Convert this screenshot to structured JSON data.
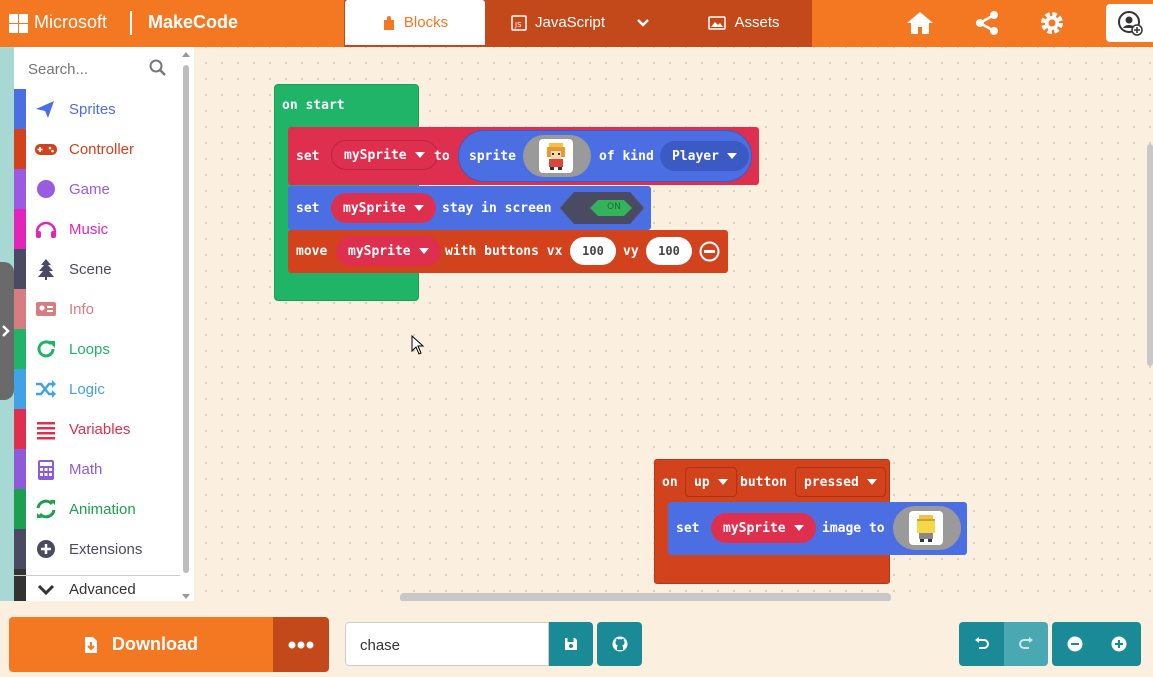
{
  "header": {
    "brand_ms": "Microsoft",
    "brand_app": "MakeCode",
    "tabs": {
      "blocks": "Blocks",
      "javascript": "JavaScript",
      "assets": "Assets"
    }
  },
  "toolbox": {
    "search_placeholder": "Search...",
    "categories": [
      {
        "label": "Sprites",
        "color": "#4b6fe2",
        "icon": "paper-plane-icon"
      },
      {
        "label": "Controller",
        "color": "#d2421c",
        "icon": "gamepad-icon"
      },
      {
        "label": "Game",
        "color": "#9a5be0",
        "icon": "circle-icon"
      },
      {
        "label": "Music",
        "color": "#e025b8",
        "icon": "headphones-icon"
      },
      {
        "label": "Scene",
        "color": "#4b4a63",
        "icon": "tree-icon"
      },
      {
        "label": "Info",
        "color": "#d67d83",
        "icon": "id-card-icon"
      },
      {
        "label": "Loops",
        "color": "#1fb468",
        "icon": "refresh-icon"
      },
      {
        "label": "Logic",
        "color": "#42a2e6",
        "icon": "shuffle-icon"
      },
      {
        "label": "Variables",
        "color": "#df2f4f",
        "icon": "list-icon"
      },
      {
        "label": "Math",
        "color": "#8e5bd8",
        "icon": "calculator-icon"
      },
      {
        "label": "Animation",
        "color": "#1e9e50",
        "icon": "cycle-icon"
      },
      {
        "label": "Extensions",
        "color": "#4b4a63",
        "icon": "plus-circle-icon"
      },
      {
        "label": "Advanced",
        "color": "#333333",
        "icon": "chevron-down-icon"
      }
    ]
  },
  "workspace": {
    "on_start": {
      "label": "on start",
      "set_sprite": {
        "set": "set",
        "var": "mySprite",
        "to": "to",
        "sprite": "sprite",
        "of_kind": "of kind",
        "kind": "Player"
      },
      "stay_in_screen": {
        "set": "set",
        "var": "mySprite",
        "text": "stay in screen",
        "toggle": "ON"
      },
      "move": {
        "move": "move",
        "var": "mySprite",
        "with": "with buttons vx",
        "vx": "100",
        "vy_label": "vy",
        "vy": "100"
      }
    },
    "on_button": {
      "on": "on",
      "button": "up",
      "button_text": "button",
      "event": "pressed",
      "set": "set",
      "var": "mySprite",
      "image_to": "image to"
    }
  },
  "footer": {
    "download": "Download",
    "project_name": "chase"
  }
}
